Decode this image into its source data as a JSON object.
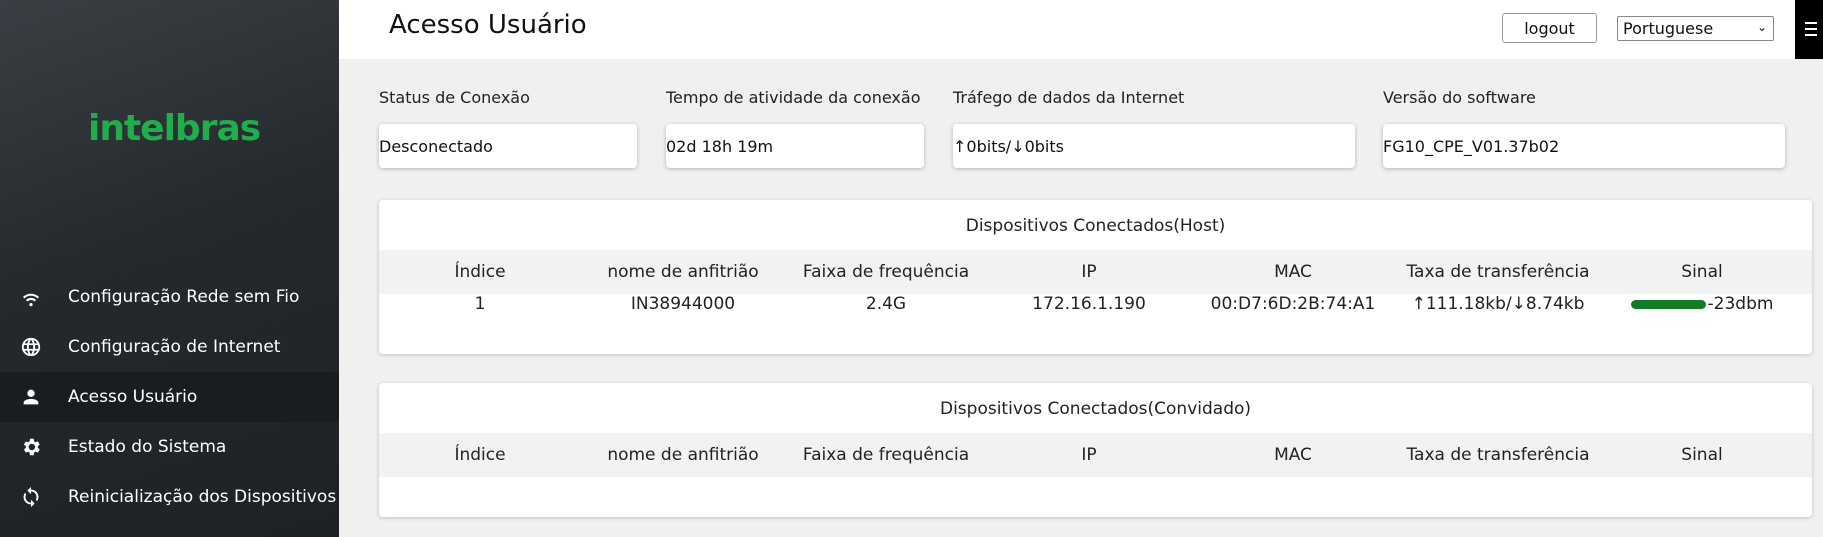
{
  "brand": {
    "logo_text": "intelbras",
    "logo_color": "#1fae4b"
  },
  "sidebar": {
    "items": [
      {
        "label": "Configuração Rede sem Fio",
        "icon": "wifi-icon"
      },
      {
        "label": "Configuração de Internet",
        "icon": "globe-icon"
      },
      {
        "label": "Acesso Usuário",
        "icon": "user-icon",
        "active": true
      },
      {
        "label": "Estado do Sistema",
        "icon": "gear-icon"
      },
      {
        "label": "Reinicialização dos Dispositivos",
        "icon": "refresh-icon"
      }
    ]
  },
  "header": {
    "title": "Acesso Usuário",
    "logout_label": "logout",
    "language": "Portuguese"
  },
  "status": {
    "connection_label": "Status de Conexão",
    "connection_value": "Desconectado",
    "uptime_label": "Tempo de atividade da conexão",
    "uptime_value": "02d 18h 19m",
    "traffic_label": "Tráfego de dados da Internet",
    "traffic_value": "↑0bits/↓0bits",
    "software_label": "Versão do software",
    "software_value": "FG10_CPE_V01.37b02"
  },
  "columns": [
    "Índice",
    "nome de anfitrião",
    "Faixa de frequência",
    "IP",
    "MAC",
    "Taxa de transferência",
    "Sinal"
  ],
  "host_table": {
    "title": "Dispositivos Conectados(Host)",
    "rows": [
      {
        "index": "1",
        "hostname": "IN38944000",
        "band": "2.4G",
        "ip": "172.16.1.190",
        "mac": "00:D7:6D:2B:74:A1",
        "rate": "↑111.18kb/↓8.74kb",
        "signal": "-23dbm"
      }
    ]
  },
  "guest_table": {
    "title": "Dispositivos Conectados(Convidado)",
    "rows": []
  },
  "colors": {
    "sidebar_bg": "#24292d",
    "signal_bar": "#137a26"
  }
}
